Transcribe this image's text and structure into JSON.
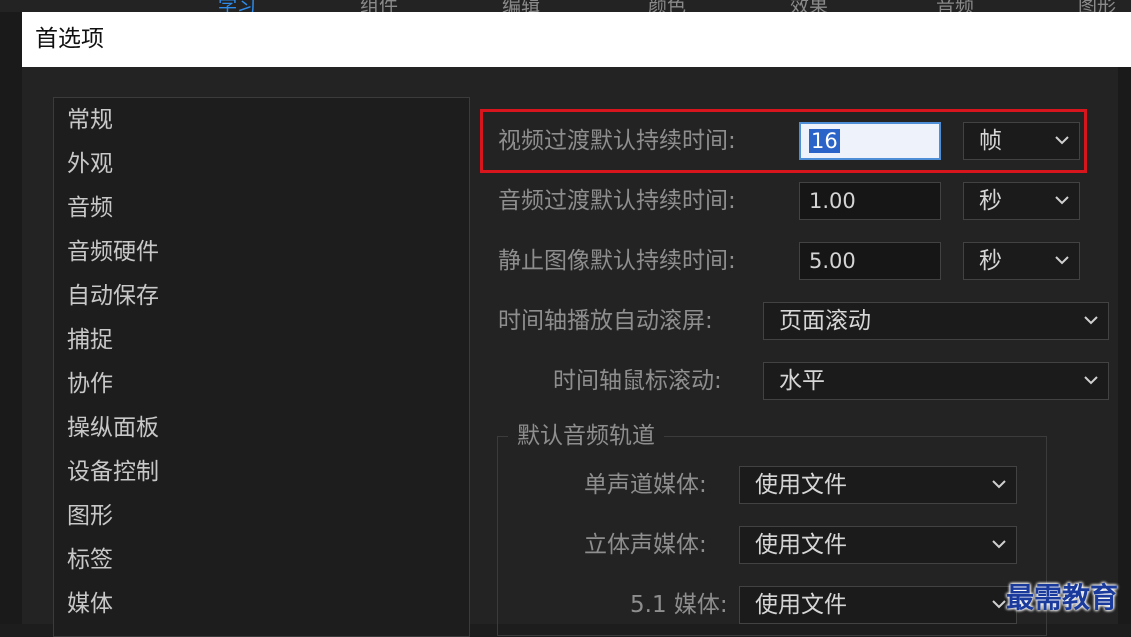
{
  "top_menu": {
    "tabs": [
      "学习",
      "组件",
      "编辑",
      "颜色",
      "效果",
      "音频",
      "图形"
    ]
  },
  "dialog": {
    "title": "首选项"
  },
  "sidebar": {
    "items": [
      "常规",
      "外观",
      "音频",
      "音频硬件",
      "自动保存",
      "捕捉",
      "协作",
      "操纵面板",
      "设备控制",
      "图形",
      "标签",
      "媒体"
    ]
  },
  "settings": {
    "video_transition": {
      "label": "视频过渡默认持续时间:",
      "value": "16",
      "unit": "帧"
    },
    "audio_transition": {
      "label": "音频过渡默认持续时间:",
      "value": "1.00",
      "unit": "秒"
    },
    "still_image": {
      "label": "静止图像默认持续时间:",
      "value": "5.00",
      "unit": "秒"
    },
    "timeline_autoscroll": {
      "label": "时间轴播放自动滚屏:",
      "value": "页面滚动"
    },
    "timeline_mouse_scroll": {
      "label": "时间轴鼠标滚动:",
      "value": "水平"
    }
  },
  "audio_tracks": {
    "title": "默认音频轨道",
    "mono": {
      "label": "单声道媒体:",
      "value": "使用文件"
    },
    "stereo": {
      "label": "立体声媒体:",
      "value": "使用文件"
    },
    "surround": {
      "label": "5.1 媒体:",
      "value": "使用文件"
    }
  },
  "watermark": "最需教育",
  "colors": {
    "highlight": "#d6151c",
    "focus_border": "#4d8ed6",
    "active_tab": "#2d8ceb",
    "watermark": "#1a3b9c"
  }
}
